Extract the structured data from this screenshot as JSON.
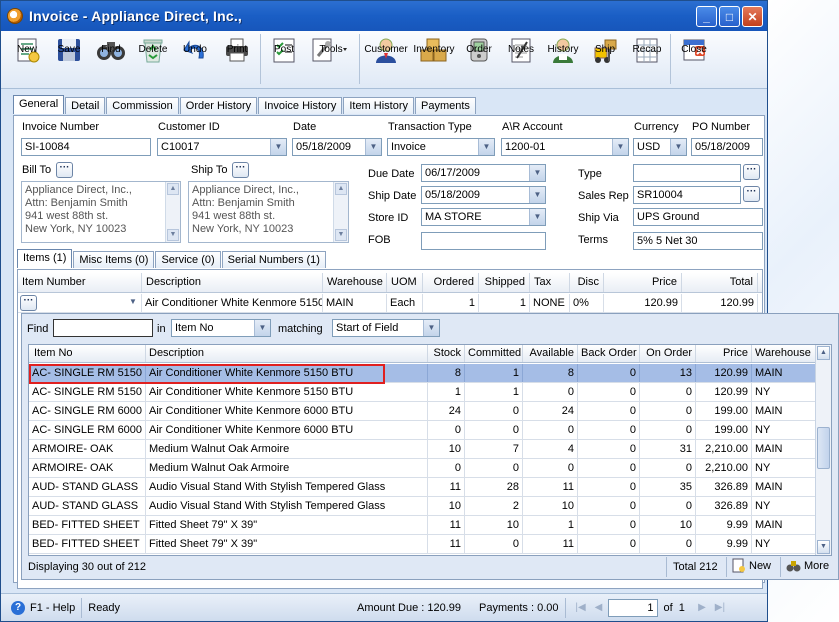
{
  "window": {
    "title": "Invoice - Appliance Direct, Inc.,",
    "buttons": {
      "minimize": "_",
      "maximize": "□",
      "close": "✕"
    }
  },
  "toolbar": [
    {
      "label": "New",
      "icon": "new-document-icon"
    },
    {
      "label": "Save",
      "icon": "save-disk-icon"
    },
    {
      "label": "Find",
      "icon": "binoculars-icon"
    },
    {
      "label": "Delete",
      "icon": "recycle-bin-icon"
    },
    {
      "label": "Undo",
      "icon": "undo-arrow-icon"
    },
    {
      "label": "Print",
      "icon": "printer-icon"
    },
    {
      "label": "Post",
      "icon": "post-checklist-icon"
    },
    {
      "label": "Tools",
      "icon": "tools-icon"
    },
    {
      "label": "Customer",
      "icon": "customer-icon"
    },
    {
      "label": "Inventory",
      "icon": "inventory-boxes-icon"
    },
    {
      "label": "Order",
      "icon": "order-device-icon"
    },
    {
      "label": "Notes",
      "icon": "notepad-icon"
    },
    {
      "label": "History",
      "icon": "history-person-icon"
    },
    {
      "label": "Ship",
      "icon": "forklift-icon"
    },
    {
      "label": "Recap",
      "icon": "recap-sheet-icon"
    },
    {
      "label": "Close",
      "icon": "close-window-icon"
    }
  ],
  "main_tabs": [
    "General",
    "Detail",
    "Commission",
    "Order History",
    "Invoice History",
    "Item History",
    "Payments"
  ],
  "header_fields": {
    "invoice_number": {
      "label": "Invoice Number",
      "value": "SI-10084"
    },
    "customer_id": {
      "label": "Customer ID",
      "value": "C10017"
    },
    "date": {
      "label": "Date",
      "value": "05/18/2009"
    },
    "transaction_type": {
      "label": "Transaction Type",
      "value": "Invoice"
    },
    "ar_account": {
      "label": "A\\R Account",
      "value": "1200-01"
    },
    "currency": {
      "label": "Currency",
      "value": "USD"
    },
    "po_number": {
      "label": "PO Number",
      "value": "05/18/2009"
    }
  },
  "bill_to": {
    "label": "Bill To",
    "lines": [
      "Appliance Direct, Inc.,",
      "Attn: Benjamin Smith",
      "941 west 88th st.",
      "New York, NY 10023"
    ]
  },
  "ship_to": {
    "label": "Ship To",
    "lines": [
      "Appliance Direct, Inc.,",
      "Attn: Benjamin Smith",
      "941 west 88th st.",
      "New York, NY 10023"
    ]
  },
  "middle_fields": {
    "due_date": {
      "label": "Due Date",
      "value": "06/17/2009"
    },
    "ship_date": {
      "label": "Ship Date",
      "value": "05/18/2009"
    },
    "store_id": {
      "label": "Store ID",
      "value": "MA STORE"
    },
    "fob": {
      "label": "FOB",
      "value": ""
    }
  },
  "right_fields": {
    "type": {
      "label": "Type",
      "value": ""
    },
    "sales_rep": {
      "label": "Sales Rep",
      "value": "SR10004"
    },
    "ship_via": {
      "label": "Ship Via",
      "value": "UPS Ground"
    },
    "terms": {
      "label": "Terms",
      "value": "5% 5 Net 30"
    }
  },
  "sub_tabs": [
    "Items (1)",
    "Misc Items (0)",
    "Service (0)",
    "Serial Numbers (1)"
  ],
  "items_grid": {
    "columns": [
      "Item Number",
      "Description",
      "Warehouse",
      "UOM",
      "Ordered",
      "Shipped",
      "Tax",
      "Disc",
      "Price",
      "Total"
    ],
    "row": {
      "item_number": "",
      "description": "Air Conditioner White Kenmore 5150",
      "warehouse": "MAIN",
      "uom": "Each",
      "ordered": "1",
      "shipped": "1",
      "tax": "NONE",
      "disc": "0%",
      "price": "120.99",
      "total": "120.99"
    }
  },
  "lookup": {
    "find_label": "Find",
    "find_value": "",
    "in_label": "in",
    "in_value": "Item No",
    "matching_label": "matching",
    "matching_value": "Start of Field",
    "columns": [
      "Item No",
      "Description",
      "Stock",
      "Committed",
      "Available",
      "Back Order",
      "On Order",
      "Price",
      "Warehouse"
    ],
    "rows": [
      [
        "AC- SINGLE RM 5150",
        "Air Conditioner White Kenmore 5150 BTU",
        "8",
        "1",
        "8",
        "0",
        "13",
        "120.99",
        "MAIN"
      ],
      [
        "AC- SINGLE RM 5150",
        "Air Conditioner White Kenmore 5150 BTU",
        "1",
        "1",
        "0",
        "0",
        "0",
        "120.99",
        "NY"
      ],
      [
        "AC- SINGLE RM 6000",
        "Air Conditioner White Kenmore 6000 BTU",
        "24",
        "0",
        "24",
        "0",
        "0",
        "199.00",
        "MAIN"
      ],
      [
        "AC- SINGLE RM 6000",
        "Air Conditioner White Kenmore 6000 BTU",
        "0",
        "0",
        "0",
        "0",
        "0",
        "199.00",
        "NY"
      ],
      [
        "ARMOIRE- OAK",
        "Medium Walnut Oak Armoire",
        "10",
        "7",
        "4",
        "0",
        "31",
        "2,210.00",
        "MAIN"
      ],
      [
        "ARMOIRE- OAK",
        "Medium Walnut Oak Armoire",
        "0",
        "0",
        "0",
        "0",
        "0",
        "2,210.00",
        "NY"
      ],
      [
        "AUD- STAND GLASS",
        "Audio Visual Stand With Stylish Tempered Glass",
        "11",
        "28",
        "11",
        "0",
        "35",
        "326.89",
        "MAIN"
      ],
      [
        "AUD- STAND GLASS",
        "Audio Visual Stand With Stylish Tempered Glass",
        "10",
        "2",
        "10",
        "0",
        "0",
        "326.89",
        "NY"
      ],
      [
        "BED- FITTED SHEET",
        "Fitted Sheet 79\" X 39\"",
        "11",
        "10",
        "1",
        "0",
        "10",
        "9.99",
        "MAIN"
      ],
      [
        "BED- FITTED SHEET",
        "Fitted Sheet 79\" X 39\"",
        "11",
        "0",
        "11",
        "0",
        "0",
        "9.99",
        "NY"
      ]
    ],
    "selected_index": 0,
    "displaying": "Displaying 30 out of 212",
    "total": "Total 212",
    "new_label": "New",
    "more_label": "More"
  },
  "statusbar": {
    "help": "F1 - Help",
    "status": "Ready",
    "amount_due": "Amount Due : 120.99",
    "payments": "Payments : 0.00",
    "page": "1",
    "of_pages": "of  1"
  }
}
